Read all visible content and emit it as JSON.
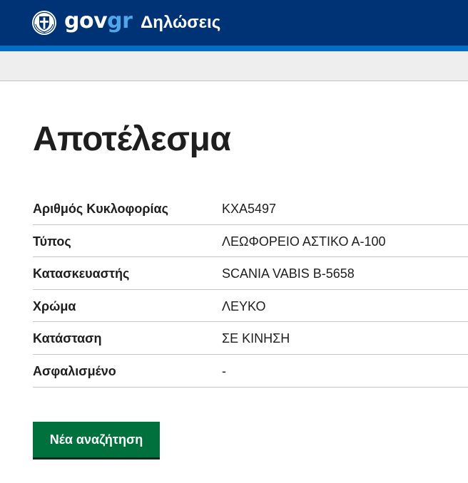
{
  "header": {
    "logo_prefix": "gov",
    "logo_suffix": "gr",
    "title": "Δηλώσεις",
    "emblem_icon": "greek-coat-of-arms-icon"
  },
  "main": {
    "title": "Αποτέλεσμα",
    "rows": [
      {
        "label": "Αριθμός Κυκλοφορίας",
        "value": "ΚΧΑ5497"
      },
      {
        "label": "Τύπος",
        "value": "ΛΕΩΦΟΡΕΙΟ ΑΣΤΙΚΟ Α-100"
      },
      {
        "label": "Κατασκευαστής",
        "value": "SCANIA VABIS B-5658"
      },
      {
        "label": "Χρώμα",
        "value": "ΛΕΥΚΟ"
      },
      {
        "label": "Κατάσταση",
        "value": "ΣΕ ΚΙΝΗΣΗ"
      },
      {
        "label": "Ασφαλισμένο",
        "value": "-"
      }
    ],
    "new_search_label": "Νέα αναζήτηση"
  },
  "colors": {
    "header_bg": "#003375",
    "header_stripe": "#046ec5",
    "logo_accent": "#4fa6e8",
    "button_bg": "#00703c"
  }
}
